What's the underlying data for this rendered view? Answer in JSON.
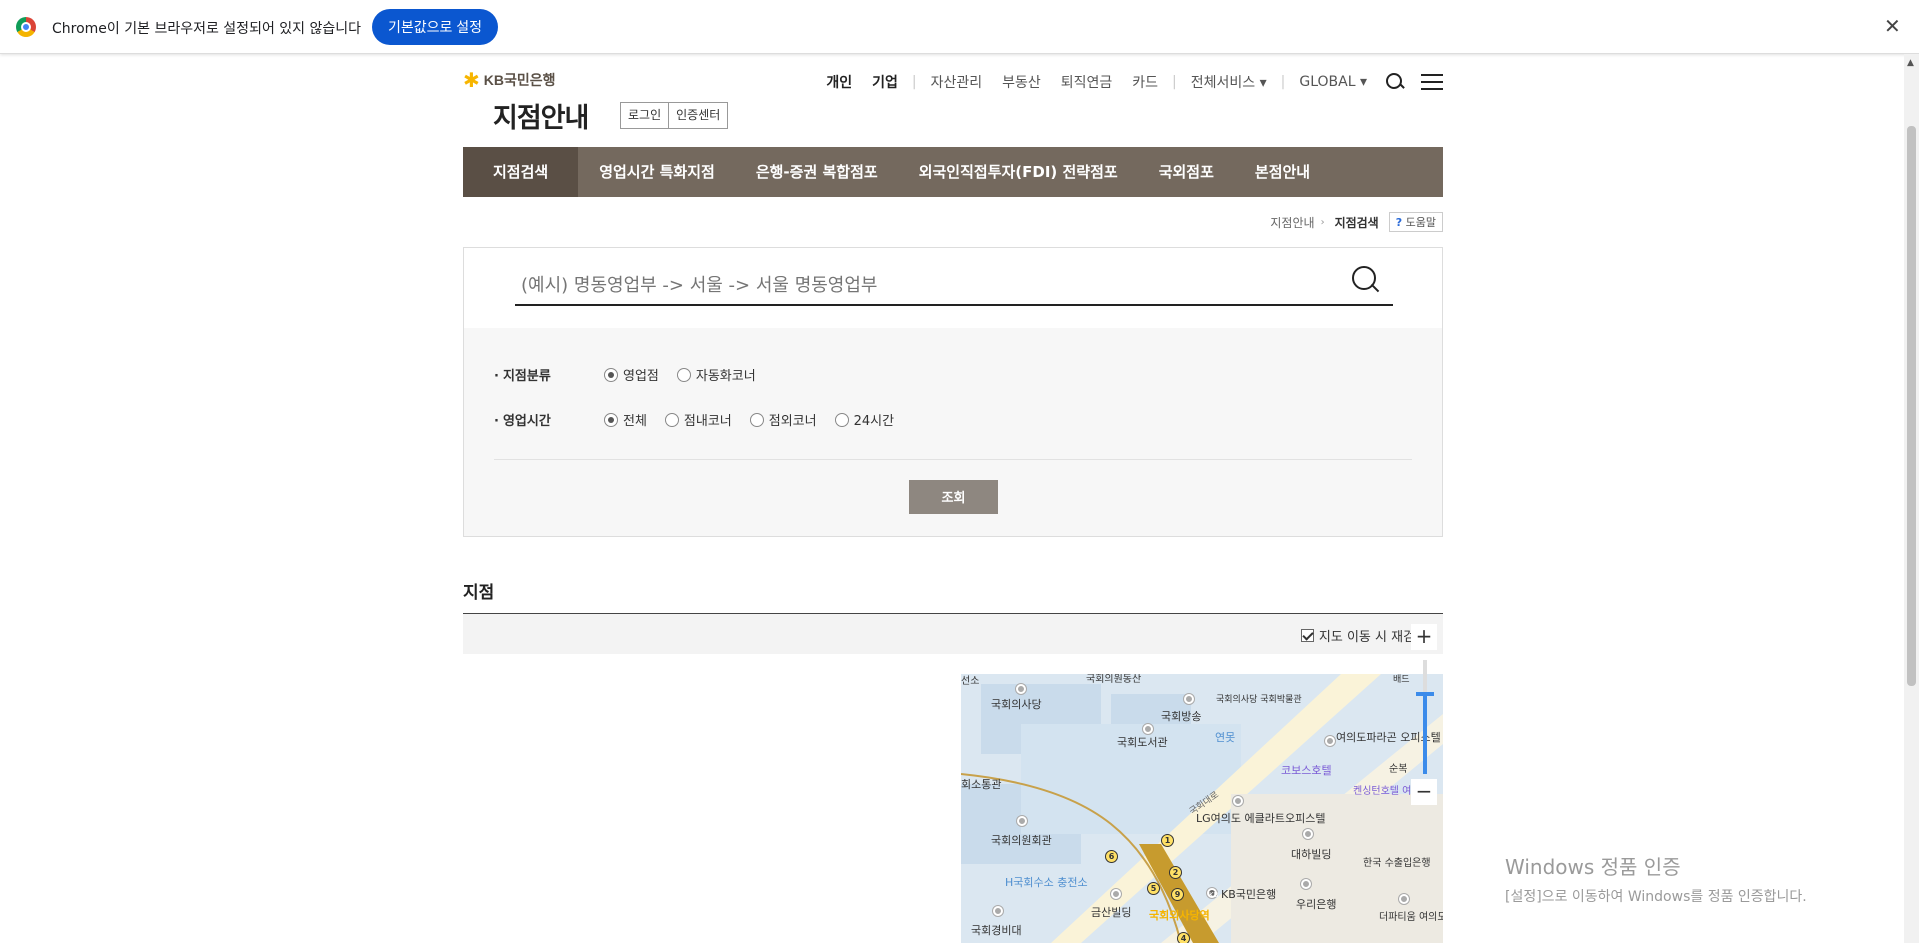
{
  "infobar": {
    "message": "Chrome이 기본 브라우저로 설정되어 있지 않습니다",
    "button": "기본값으로 설정",
    "close": "✕"
  },
  "header": {
    "logo_text": "KB국민은행",
    "page_title": "지점안내",
    "login": "로그인",
    "cert_center": "인증센터",
    "topnav": {
      "personal": "개인",
      "business": "기업",
      "assets": "자산관리",
      "realestate": "부동산",
      "pension": "퇴직연금",
      "card": "카드",
      "all_services": "전체서비스 ▾",
      "global": "GLOBAL ▾"
    }
  },
  "gnb": {
    "tabs": [
      "지점검색",
      "영업시간 특화지점",
      "은행-증권 복합점포",
      "외국인직접투자(FDI) 전략점포",
      "국외점포",
      "본점안내"
    ]
  },
  "breadcrumb": {
    "parent": "지점안내",
    "current": "지점검색",
    "help": "도움말",
    "help_mark": "?"
  },
  "search": {
    "placeholder": "(예시) 명동영업부 -> 서울 -> 서울 명동영업부",
    "branch_type_label": "지점분류",
    "branch_type_options": [
      "영업점",
      "자동화코너"
    ],
    "hours_label": "영업시간",
    "hours_options": [
      "전체",
      "점내코너",
      "점외코너",
      "24시간"
    ],
    "submit": "조회"
  },
  "results": {
    "title": "지점",
    "recheck_label": "지도 이동 시 재검색"
  },
  "map": {
    "labels": [
      "국회의사당",
      "국회방송",
      "국회의사당 국회박물관",
      "국회도서관",
      "연못",
      "여의도파라곤 오피스텔",
      "코보스호텔",
      "켄싱턴호텔 여의도",
      "회소통관",
      "국회의원회관",
      "LG여의도 에클라트오피스텔",
      "대하빌딩",
      "H국회수소 충전소",
      "KB국민은행",
      "우리은행",
      "한국 수출입은행",
      "금산빌딩",
      "국회경비대",
      "더파티움 여의도",
      "국회의사당역",
      "국회대로",
      "선소",
      "국회의원동산",
      "배드",
      "순복",
      "KB"
    ],
    "numbers": [
      "1",
      "2",
      "4",
      "5",
      "6",
      "9"
    ],
    "zoom_in": "+",
    "zoom_out": "−"
  },
  "watermark": {
    "title": "Windows 정품 인증",
    "subtitle": "[설정]으로 이동하여 Windows를 정품 인증합니다."
  }
}
